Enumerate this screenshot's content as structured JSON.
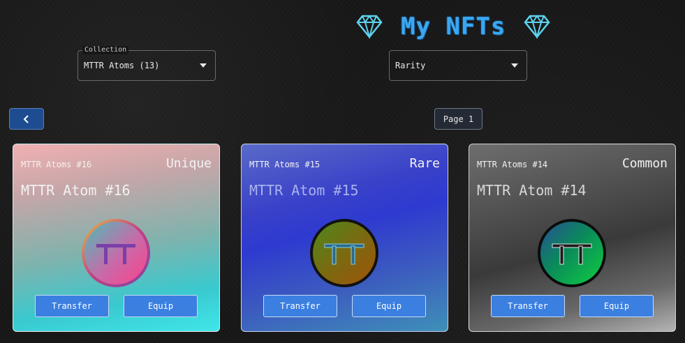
{
  "header": {
    "title": "My NFTs",
    "left_icon": "diamond-icon",
    "right_icon": "diamond-icon",
    "title_color": "#3aa8f0"
  },
  "filters": {
    "collection": {
      "legend": "Collection",
      "value": "MTTR Atoms (13)"
    },
    "rarity": {
      "value": "Rarity"
    }
  },
  "pagination": {
    "back_icon": "chevron-left-icon",
    "page_label": "Page 1"
  },
  "cards": [
    {
      "collection": "MTTR Atoms #16",
      "rarity": "Unique",
      "name": "MTTR Atom #16",
      "transfer_label": "Transfer",
      "equip_label": "Equip"
    },
    {
      "collection": "MTTR Atoms #15",
      "rarity": "Rare",
      "name": "MTTR Atom #15",
      "transfer_label": "Transfer",
      "equip_label": "Equip"
    },
    {
      "collection": "MTTR Atoms #14",
      "rarity": "Common",
      "name": "MTTR Atom #14",
      "transfer_label": "Transfer",
      "equip_label": "Equip"
    }
  ]
}
